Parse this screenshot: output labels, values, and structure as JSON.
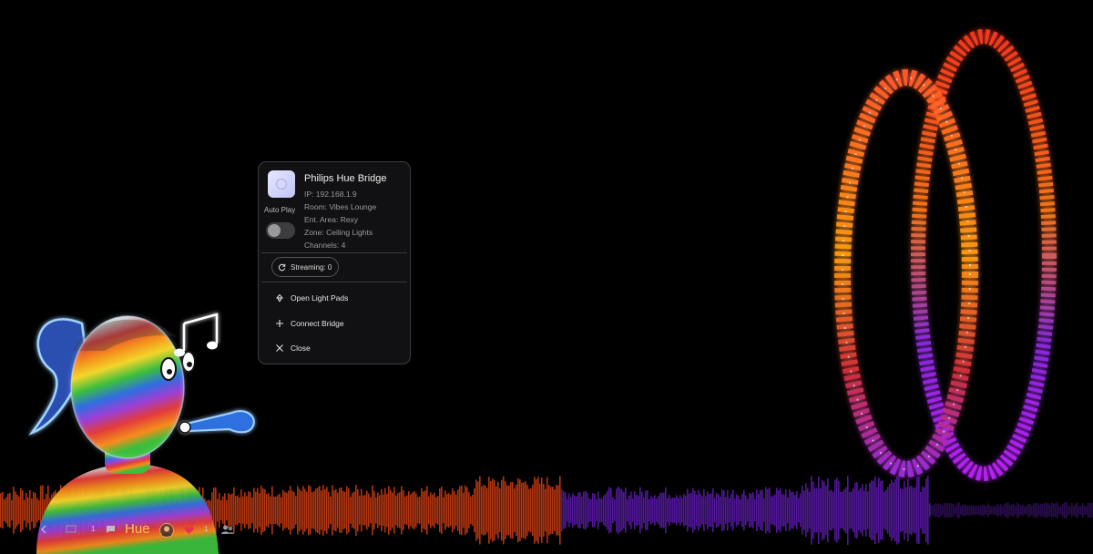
{
  "device": {
    "name": "Philips Hue Bridge",
    "ip": "IP: 192.168.1.9",
    "room": "Room: Vibes Lounge",
    "ent_area": "Ent. Area: Rexy",
    "zone": "Zone: Ceiling Lights",
    "channels": "Channels: 4",
    "icon": "hue-bridge-icon"
  },
  "autoplay": {
    "label": "Auto Play",
    "enabled": false
  },
  "streaming": {
    "label": "Streaming: 0",
    "icon": "refresh-icon"
  },
  "menu": [
    {
      "label": "Open Light Pads",
      "icon": "lamp-icon"
    },
    {
      "label": "Connect Bridge",
      "icon": "plus-icon"
    },
    {
      "label": "Close",
      "icon": "close-icon"
    }
  ],
  "bottom_bar": {
    "back_icon": "chevron-left-icon",
    "screens_icon": "screen-icon",
    "screens_count": "1",
    "chat_icon": "chat-icon",
    "brand": "Hue",
    "avatar_icon": "avatar-icon",
    "likes_icon": "heart-icon",
    "likes_count": "1",
    "people_icon": "people-icon"
  },
  "colors": {
    "accent": "#f2c94c",
    "heart": "#e8304f",
    "wave_orange": "#c43a12",
    "wave_purple": "#5a1aa8"
  }
}
